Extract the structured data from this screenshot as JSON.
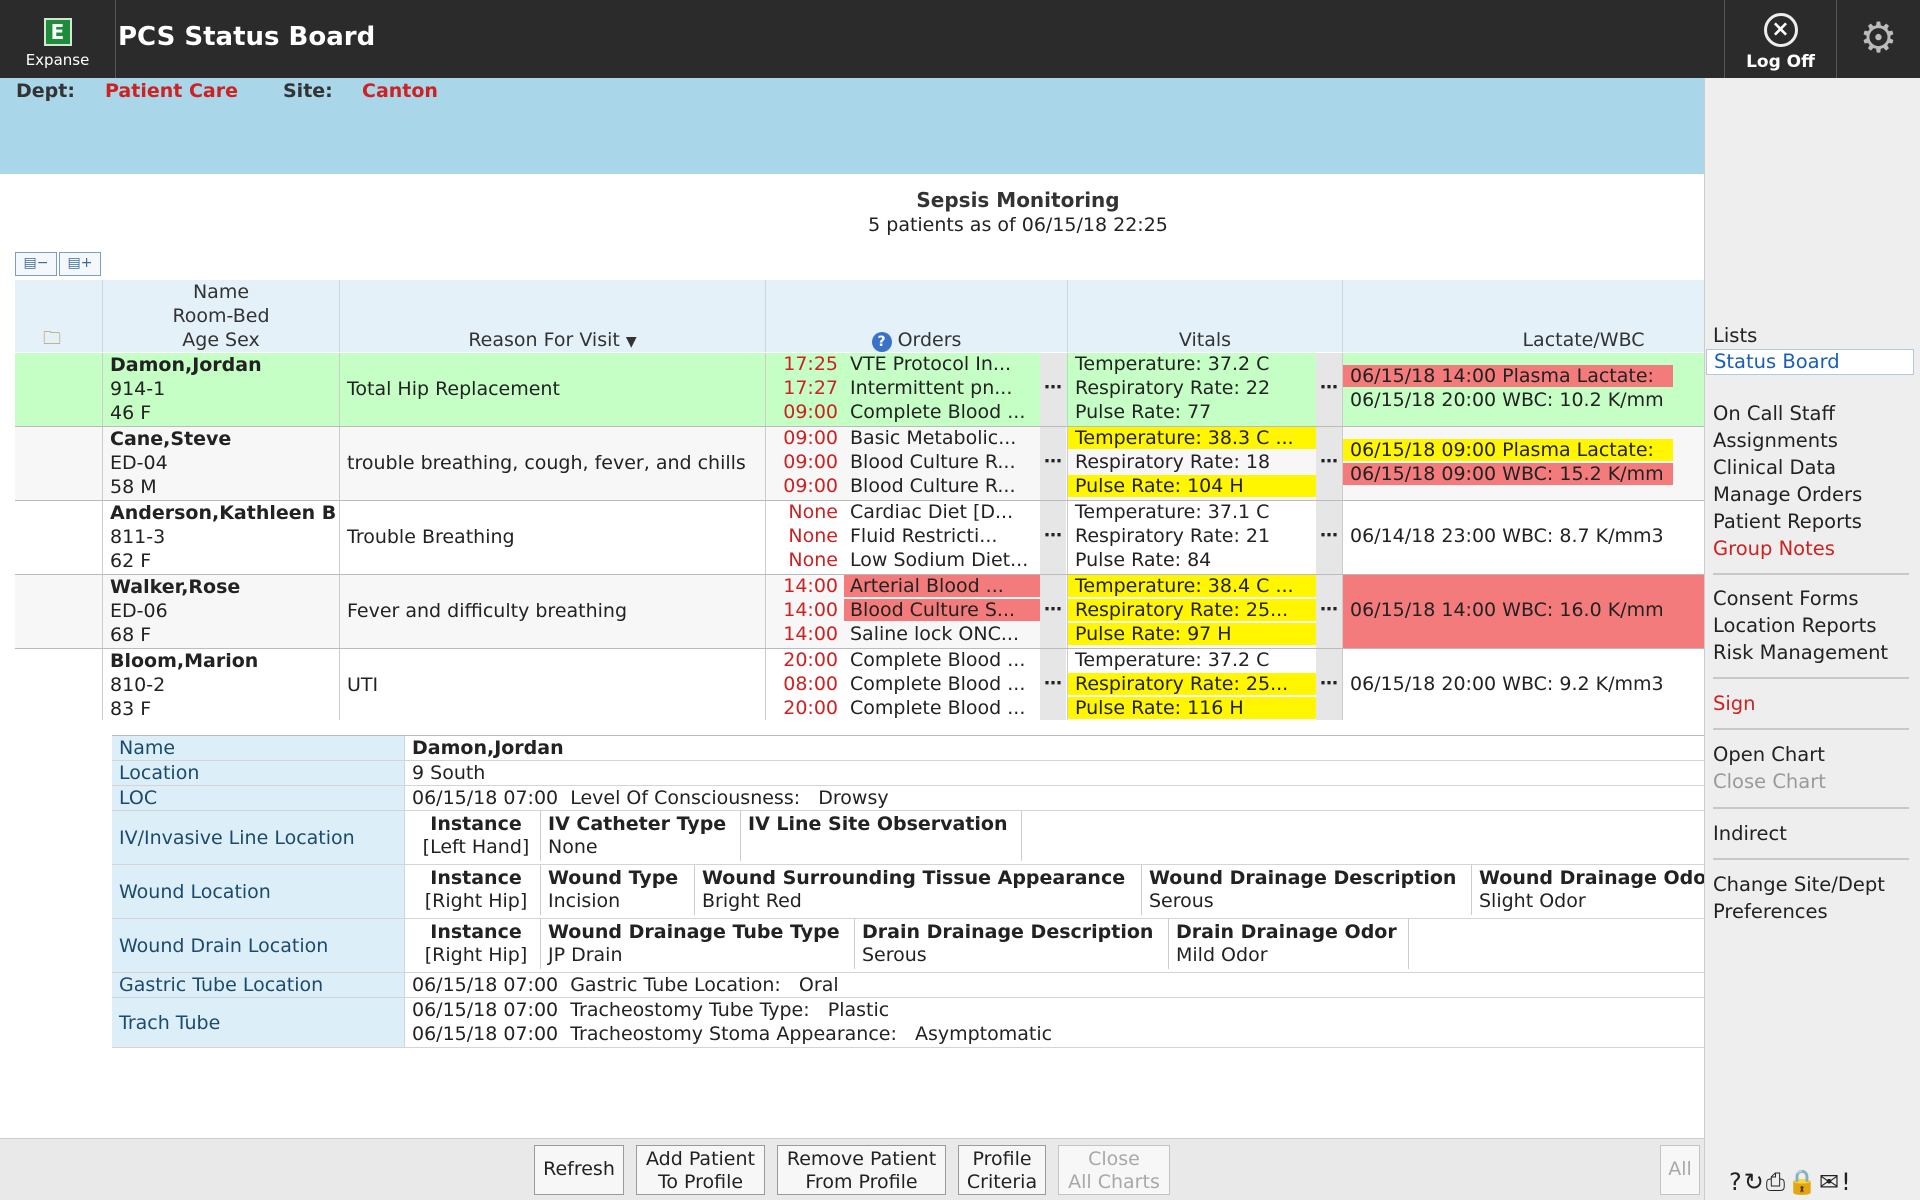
{
  "app": {
    "logo_letter": "E",
    "logo_text": "Expanse",
    "title": "PCS Status Board",
    "logoff_label": "Log Off",
    "gear_icon": "gear-icon"
  },
  "dept": {
    "dept_label": "Dept:",
    "dept_value": "Patient Care",
    "site_label": "Site:",
    "site_value": "Canton"
  },
  "board": {
    "title": "Sepsis Monitoring",
    "subtitle": "5 patients as of 06/15/18 22:25"
  },
  "columns": {
    "name": [
      "Name",
      "Room-Bed",
      "Age Sex"
    ],
    "reason": "Reason For Visit",
    "orders": "Orders",
    "vitals": "Vitals",
    "lactate": "Lactate/WBC"
  },
  "patients": [
    {
      "name": "Damon,Jordan",
      "room": "914-1",
      "agesex": "46 F",
      "reason": "Total Hip Replacement",
      "orders": [
        {
          "time": "17:25",
          "text": "VTE Protocol In..."
        },
        {
          "time": "17:27",
          "text": "Intermittent pn..."
        },
        {
          "time": "09:00",
          "text": "Complete Blood ..."
        }
      ],
      "vitals": [
        "Temperature: 37.2 C",
        "Respiratory Rate: 22",
        "Pulse Rate: 77"
      ],
      "lactate": [
        "06/15/18 14:00  Plasma Lactate:",
        "06/15/18 20:00  WBC:    10.2 K/mm"
      ]
    },
    {
      "name": "Cane,Steve",
      "room": "ED-04",
      "agesex": "58 M",
      "reason": "trouble breathing, cough, fever, and chills",
      "orders": [
        {
          "time": "09:00",
          "text": "Basic Metabolic..."
        },
        {
          "time": "09:00",
          "text": "Blood Culture R..."
        },
        {
          "time": "09:00",
          "text": "Blood Culture R..."
        }
      ],
      "vitals": [
        "Temperature: 38.3 C ...",
        "Respiratory Rate: 18",
        "Pulse Rate: 104 H"
      ],
      "lactate": [
        "06/15/18 09:00  Plasma Lactate:",
        "06/15/18 09:00  WBC:    15.2 K/mm"
      ]
    },
    {
      "name": "Anderson,Kathleen B",
      "room": "811-3",
      "agesex": "62 F",
      "reason": "Trouble Breathing",
      "orders": [
        {
          "time": "None",
          "text": "Cardiac Diet [D..."
        },
        {
          "time": "None",
          "text": "Fluid Restricti..."
        },
        {
          "time": "None",
          "text": "Low Sodium Diet..."
        }
      ],
      "vitals": [
        "Temperature: 37.1 C",
        "Respiratory Rate: 21",
        "Pulse Rate: 84"
      ],
      "lactate": [
        "06/14/18 23:00  WBC:    8.7 K/mm3"
      ]
    },
    {
      "name": "Walker,Rose",
      "room": "ED-06",
      "agesex": "68 F",
      "reason": "Fever and difficulty breathing",
      "orders": [
        {
          "time": "14:00",
          "text": "Arterial Blood ..."
        },
        {
          "time": "14:00",
          "text": "Blood Culture S..."
        },
        {
          "time": "14:00",
          "text": "Saline lock ONC..."
        }
      ],
      "vitals": [
        "Temperature: 38.4 C ...",
        "Respiratory Rate: 25...",
        "Pulse Rate: 97 H"
      ],
      "lactate": [
        "06/15/18 14:00  WBC:    16.0 K/mm"
      ]
    },
    {
      "name": "Bloom,Marion",
      "room": "810-2",
      "agesex": "83 F",
      "reason": "UTI",
      "orders": [
        {
          "time": "20:00",
          "text": "Complete Blood ..."
        },
        {
          "time": "08:00",
          "text": "Complete Blood ..."
        },
        {
          "time": "20:00",
          "text": "Complete Blood ..."
        }
      ],
      "vitals": [
        "Temperature: 37.2 C",
        "Respiratory Rate: 25...",
        "Pulse Rate: 116 H"
      ],
      "lactate": [
        "06/15/18 20:00  WBC:    9.2 K/mm3"
      ]
    }
  ],
  "colors": {
    "row_green": "#c6ffc6",
    "highlight_yellow": "#fff600",
    "highlight_red": "#f47b7b",
    "alert_text_red": "#cc2222",
    "band_blue": "#a9d6e8"
  },
  "detail": {
    "name_label": "Name",
    "name_value": "Damon,Jordan",
    "location_label": "Location",
    "location_value": "9 South",
    "loc_label": "LOC",
    "loc_value": "06/15/18 07:00  Level Of Consciousness:   Drowsy",
    "iv_label": "IV/Invasive Line Location",
    "iv_headers": [
      "Instance",
      "IV Catheter Type",
      "IV Line Site Observation"
    ],
    "iv_values": [
      "[Left Hand]",
      "None",
      ""
    ],
    "wound_label": "Wound Location",
    "wound_headers": [
      "Instance",
      "Wound Type",
      "Wound Surrounding Tissue Appearance",
      "Wound Drainage Description",
      "Wound Drainage Odor"
    ],
    "wound_values": [
      "[Right Hip]",
      "Incision",
      "Bright Red",
      "Serous",
      "Slight Odor"
    ],
    "drain_label": "Wound Drain Location",
    "drain_headers": [
      "Instance",
      "Wound Drainage Tube Type",
      "Drain Drainage Description",
      "Drain Drainage Odor"
    ],
    "drain_values": [
      "[Right Hip]",
      "JP Drain",
      "Serous",
      "Mild Odor"
    ],
    "gastric_label": "Gastric Tube Location",
    "gastric_value": "06/15/18 07:00  Gastric Tube Location:   Oral",
    "trach_label": "Trach Tube",
    "trach_values": [
      "06/15/18 07:00  Tracheostomy Tube Type:   Plastic",
      "06/15/18 07:00  Tracheostomy Stoma Appearance:   Asymptomatic"
    ]
  },
  "sidebar": {
    "lists": "Lists",
    "status_board": "Status Board",
    "on_call": "On Call Staff",
    "assignments": "Assignments",
    "clinical_data": "Clinical Data",
    "manage_orders": "Manage Orders",
    "patient_reports": "Patient Reports",
    "group_notes": "Group Notes",
    "consent_forms": "Consent Forms",
    "location_reports": "Location Reports",
    "risk_management": "Risk Management",
    "sign": "Sign",
    "open_chart": "Open Chart",
    "close_chart": "Close Chart",
    "indirect": "Indirect",
    "change_site": "Change Site/Dept",
    "preferences": "Preferences"
  },
  "buttons": {
    "refresh": "Refresh",
    "add_1": "Add Patient",
    "add_2": "To Profile",
    "remove_1": "Remove Patient",
    "remove_2": "From Profile",
    "profile_1": "Profile",
    "profile_2": "Criteria",
    "close_1": "Close",
    "close_2": "All Charts",
    "all": "All"
  }
}
